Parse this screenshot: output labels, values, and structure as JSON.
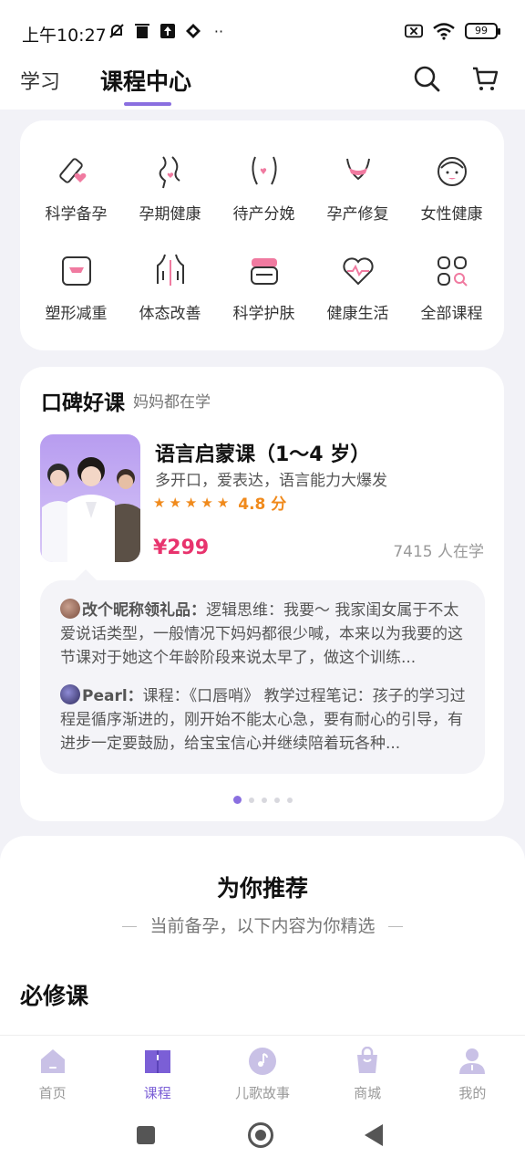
{
  "status_bar": {
    "time": "上午10:27",
    "battery": "99",
    "icons": [
      "mute-icon",
      "trash-icon",
      "upload-icon",
      "app-icon",
      "more-icon",
      "sim-off-icon",
      "wifi-icon",
      "battery-icon"
    ]
  },
  "top_nav": {
    "tab_study": "学习",
    "tab_center": "课程中心",
    "accent_color": "#8a6fe0"
  },
  "categories": [
    {
      "label": "科学备孕",
      "icon": "pregnancy-test-icon"
    },
    {
      "label": "孕期健康",
      "icon": "pregnant-belly-icon"
    },
    {
      "label": "待产分娩",
      "icon": "birth-icon"
    },
    {
      "label": "孕产修复",
      "icon": "body-recovery-icon"
    },
    {
      "label": "女性健康",
      "icon": "woman-face-icon"
    },
    {
      "label": "塑形减重",
      "icon": "scale-icon"
    },
    {
      "label": "体态改善",
      "icon": "posture-icon"
    },
    {
      "label": "科学护肤",
      "icon": "skincare-jar-icon"
    },
    {
      "label": "健康生活",
      "icon": "heart-pulse-icon"
    },
    {
      "label": "全部课程",
      "icon": "all-courses-icon"
    }
  ],
  "popular": {
    "title": "口碑好课",
    "subtitle": "妈妈都在学",
    "course": {
      "title": "语言启蒙课（1～4 岁）",
      "desc": "多开口，爱表达，语言能力大爆发",
      "rating": "4.8 分",
      "stars": 5,
      "price": "¥299",
      "learners": "7415 人在学"
    },
    "reviews": [
      {
        "name": "改个昵称领礼品：",
        "text": "逻辑思维：我要～ 我家闺女属于不太爱说话类型，一般情况下妈妈都很少喊，本来以为我要的这节课对于她这个年龄阶段来说太早了，做这个训练..."
      },
      {
        "name": "Pearl：",
        "text": "课程：《口唇哨》 教学过程笔记：孩子的学习过程是循序渐进的，刚开始不能太心急，要有耐心的引导，有进步一定要鼓励，给宝宝信心并继续陪着玩各种..."
      }
    ],
    "carousel_count": 5,
    "carousel_active": 0
  },
  "recommend": {
    "title": "为你推荐",
    "subtitle": "当前备孕，以下内容为你精选",
    "must_title": "必修课"
  },
  "tabbar": [
    {
      "label": "首页",
      "icon": "home-icon",
      "active": false
    },
    {
      "label": "课程",
      "icon": "book-icon",
      "active": true
    },
    {
      "label": "儿歌故事",
      "icon": "music-icon",
      "active": false
    },
    {
      "label": "商城",
      "icon": "shop-bag-icon",
      "active": false
    },
    {
      "label": "我的",
      "icon": "profile-icon",
      "active": false
    }
  ]
}
